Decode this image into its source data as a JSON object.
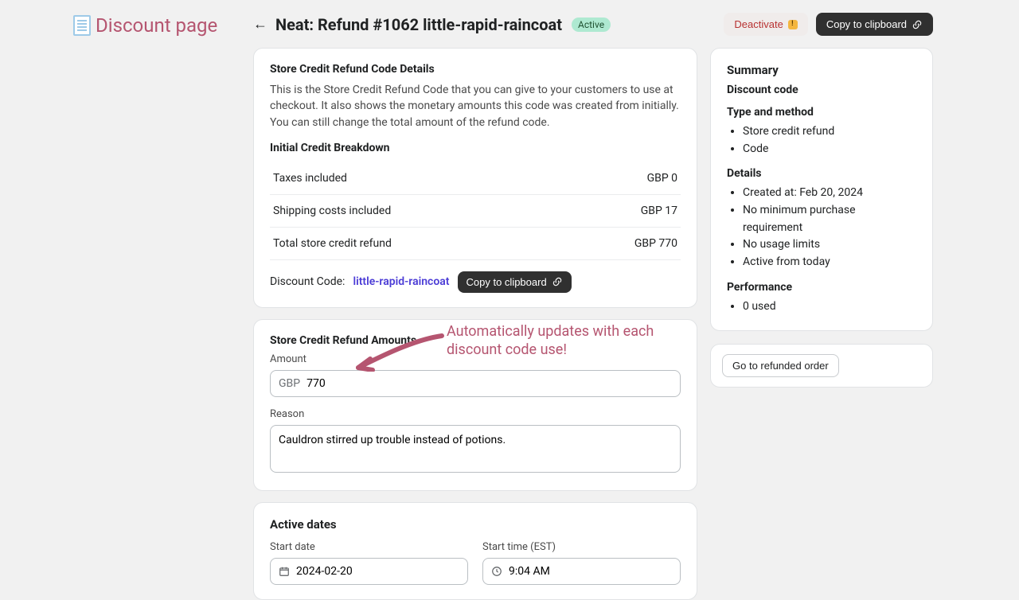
{
  "page_label": "Discount page",
  "header": {
    "title": "Neat: Refund #1062 little-rapid-raincoat",
    "status": "Active",
    "deactivate_label": "Deactivate",
    "copy_label": "Copy to clipboard"
  },
  "details_card": {
    "title": "Store Credit Refund Code Details",
    "description": "This is the Store Credit Refund Code that you can give to your customers to use at checkout. It also shows the monetary amounts this code was created from initially. You can still change the total amount of the refund code.",
    "breakdown_heading": "Initial Credit Breakdown",
    "rows": [
      {
        "label": "Taxes included",
        "value": "GBP 0"
      },
      {
        "label": "Shipping costs included",
        "value": "GBP 17"
      },
      {
        "label": "Total store credit refund",
        "value": "GBP 770"
      }
    ],
    "discount_code_label": "Discount Code:",
    "discount_code": "little-rapid-raincoat",
    "copy_label": "Copy to clipboard"
  },
  "amounts_card": {
    "title": "Store Credit Refund Amounts",
    "amount_label": "Amount",
    "currency_prefix": "GBP",
    "amount_value": "770",
    "reason_label": "Reason",
    "reason_value": "Cauldron stirred up trouble instead of potions."
  },
  "dates_card": {
    "title": "Active dates",
    "start_date_label": "Start date",
    "start_date_value": "2024-02-20",
    "start_time_label": "Start time (EST)",
    "start_time_value": "9:04 AM"
  },
  "annotation": "Automatically updates with each discount code use!",
  "summary": {
    "title": "Summary",
    "code_heading": "Discount code",
    "type_heading": "Type and method",
    "type_items": [
      "Store credit refund",
      "Code"
    ],
    "details_heading": "Details",
    "details_items": [
      "Created at: Feb 20, 2024",
      "No minimum purchase requirement",
      "No usage limits",
      "Active from today"
    ],
    "performance_heading": "Performance",
    "performance_items": [
      "0 used"
    ]
  },
  "go_to_order": "Go to refunded order"
}
